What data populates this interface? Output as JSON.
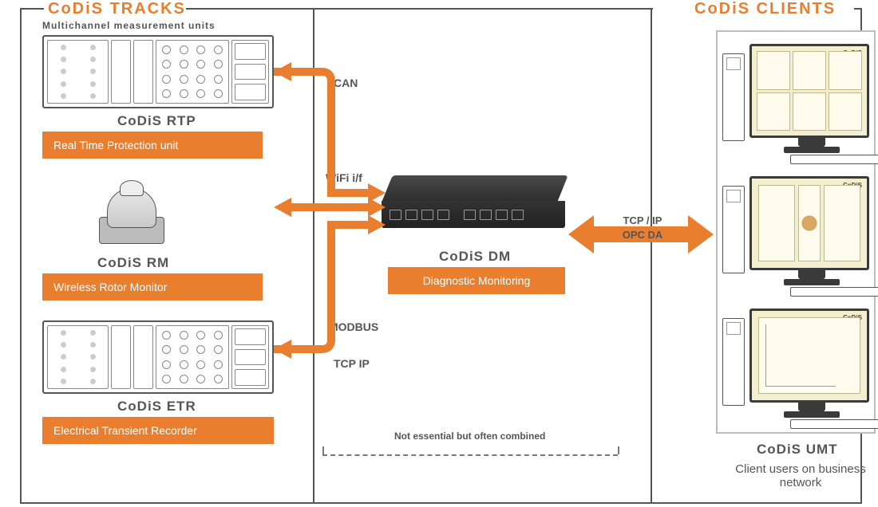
{
  "header_tracks": "CoDiS TRACKS",
  "header_clients": "CoDiS CLIENTS",
  "devices": {
    "rtp": {
      "name": "CoDiS RTP",
      "desc": "Real Time Protection unit",
      "protocol": "CAN"
    },
    "rm": {
      "name": "CoDiS RM",
      "desc": "Wireless Rotor Monitor",
      "protocol": "WiFi i/f"
    },
    "etr": {
      "name": "CoDiS ETR",
      "desc": "Electrical Transient Recorder",
      "protocol": "MODBUS TCP IP"
    }
  },
  "center": {
    "name": "CoDiS DM",
    "desc": "Diagnostic Monitoring"
  },
  "center_proto": "TCP / IP OPC DA",
  "clients": {
    "name": "CoDiS UMT",
    "desc": "Client users on business network",
    "brand": "CoDiS"
  },
  "combined": "Not essential but often combined"
}
